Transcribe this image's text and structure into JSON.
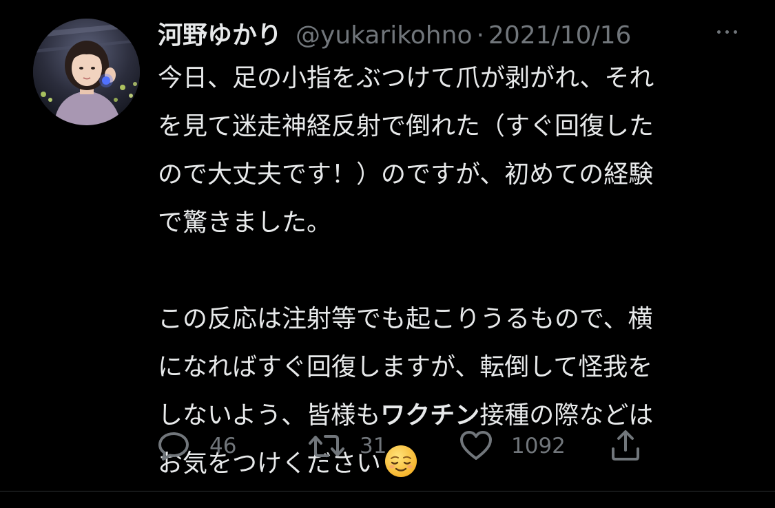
{
  "tweet": {
    "author_name": "河野ゆかり",
    "author_handle": "@yukarikohno",
    "separator": "·",
    "date": "2021/10/16",
    "text_lines": [
      "今日、足の小指をぶつけて爪が剥がれ、それ",
      "を見て迷走神経反射で倒れた（すぐ回復した",
      "ので大丈夫です！）のですが、初めての経験",
      "で驚きました。",
      "この反応は注射等でも起こりうるもので、横",
      "になればすぐ回復しますが、転倒して怪我を"
    ],
    "line7_prefix": "しないよう、皆様も",
    "line7_bold": "ワクチン",
    "line7_suffix": "接種の際などは",
    "line8_text": "お気をつけください",
    "emoji": "relieved-face-emoji"
  },
  "actions": {
    "reply_count": "46",
    "retweet_count": "31",
    "like_count": "1092"
  },
  "colors": {
    "background": "#000000",
    "text_primary": "#e7e9ea",
    "text_secondary": "#71767b",
    "divider": "#2f3336"
  }
}
